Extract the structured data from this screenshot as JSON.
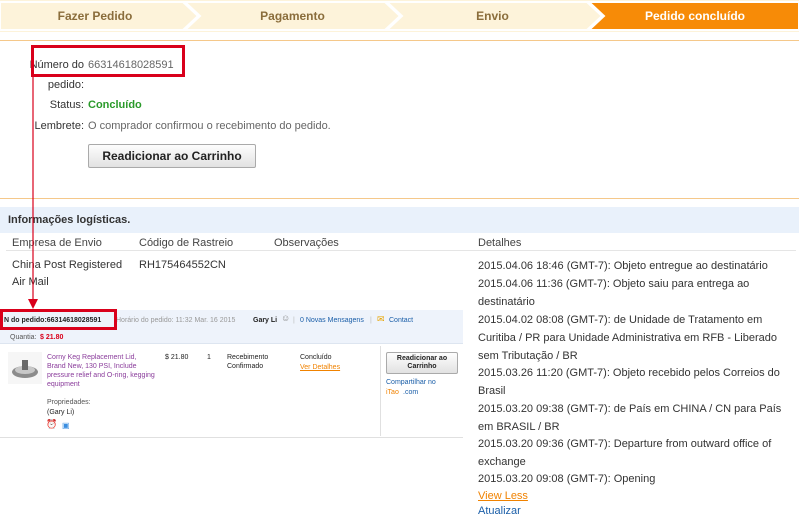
{
  "steps": [
    {
      "label": "Fazer Pedido"
    },
    {
      "label": "Pagamento"
    },
    {
      "label": "Envio"
    },
    {
      "label": "Pedido concluído"
    }
  ],
  "order": {
    "number_label_1": "Número do",
    "number_label_2": "pedido:",
    "number_value": "66314618028591",
    "status_label": "Status:",
    "status_value": "Concluído",
    "reminder_label": "Lembrete:",
    "reminder_value": "O comprador confirmou o recebimento do pedido.",
    "readd_button": "Readicionar ao Carrinho"
  },
  "logistics": {
    "title": "Informações logísticas.",
    "columns": [
      "Empresa de Envio",
      "Código de Rastreio",
      "Observações",
      "Detalhes"
    ],
    "carrier": "China Post Registered Air Mail",
    "tracking": "RH175464552CN",
    "details": [
      "2015.04.06 18:46 (GMT-7): Objeto entregue ao destinatário",
      "2015.04.06 11:36 (GMT-7): Objeto saiu para entrega ao destinatário",
      "2015.04.02 08:08 (GMT-7): de Unidade de Tratamento em Curitiba / PR para Unidade Administrativa em RFB - Liberado sem Tributação / BR",
      "2015.03.26 11:20 (GMT-7): Objeto recebido pelos Correios do Brasil",
      "2015.03.20 09:38 (GMT-7): de País em CHINA / CN para País em BRASIL / BR",
      "2015.03.20 09:36 (GMT-7): Departure from outward office of exchange",
      "2015.03.20 09:08 (GMT-7): Opening"
    ],
    "view_less": "View Less",
    "refresh": "Atualizar"
  },
  "embedded": {
    "order_no": "N do pedido:66314618028591",
    "order_time": "Horário do pedido: 11:32 Mar. 16 2015",
    "seller": "Gary Li",
    "messages": "0 Novas Mensagens",
    "contact": "Contact",
    "qty_label": "Quantia:",
    "qty_value": "$ 21.80",
    "product": "Corny Keg Replacement Lid, Brand New, 130 PSI, Include pressure relief and O-ring, kegging equipment",
    "props_label": "Propriedades:",
    "props_value": "(Gary Li)",
    "price": "$ 21.80",
    "qty": "1",
    "received": "Recebimento Confirmado",
    "status": "Concluído",
    "details_link": "Ver Detalhes",
    "readd_button": "Readicionar ao Carrinho",
    "share_1": "Compartilhar no",
    "share_2a": "iTao",
    "share_2b": ".com"
  },
  "colors": {
    "step_inactive": "#fdf3da",
    "step_active": "#f78b07",
    "highlight": "#d9001b",
    "status": "#2a9a2a"
  }
}
